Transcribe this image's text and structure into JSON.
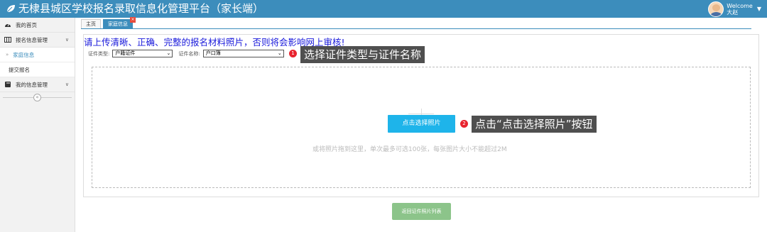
{
  "header": {
    "title": "无棣县城区学校报名录取信息化管理平台（家长端）",
    "welcome": "Welcome",
    "username": "大赵"
  },
  "sidebar": {
    "items": [
      {
        "label": "我的首页",
        "icon": "gauge-icon"
      },
      {
        "label": "报名信息管理",
        "icon": "grid-icon",
        "expanded": true
      },
      {
        "label": "家庭信息",
        "sub": true,
        "active": true
      },
      {
        "label": "提交报名",
        "sub": true
      },
      {
        "label": "我的信息管理",
        "icon": "book-icon"
      }
    ],
    "collapse_symbol": "«"
  },
  "tabs": [
    {
      "label": "主页"
    },
    {
      "label": "家庭信息",
      "active": true,
      "close": "×"
    }
  ],
  "main": {
    "warning": "请上传清晰、正确、完整的报名材料照片，否则将会影响网上审核!",
    "cert_type_label": "证件类型:",
    "cert_type_value": "户籍证件",
    "cert_name_label": "证件名称:",
    "cert_name_value": "户口簿",
    "choose_button": "点击选择照片",
    "drop_hint": "或将照片拖到这里，单次最多可选100张，每张图片大小不能超过2M",
    "return_button": "返回证件照片列表"
  },
  "annotations": [
    {
      "number": "1",
      "text": "选择证件类型与证件名称"
    },
    {
      "number": "2",
      "text": "点击“点击选择照片”按钮"
    }
  ],
  "colors": {
    "header": "#3c8dbc",
    "choose_button": "#1eb4ea",
    "return_button": "#8cc48a",
    "warning_text": "#1a1adb",
    "marker": "#e8242f"
  }
}
